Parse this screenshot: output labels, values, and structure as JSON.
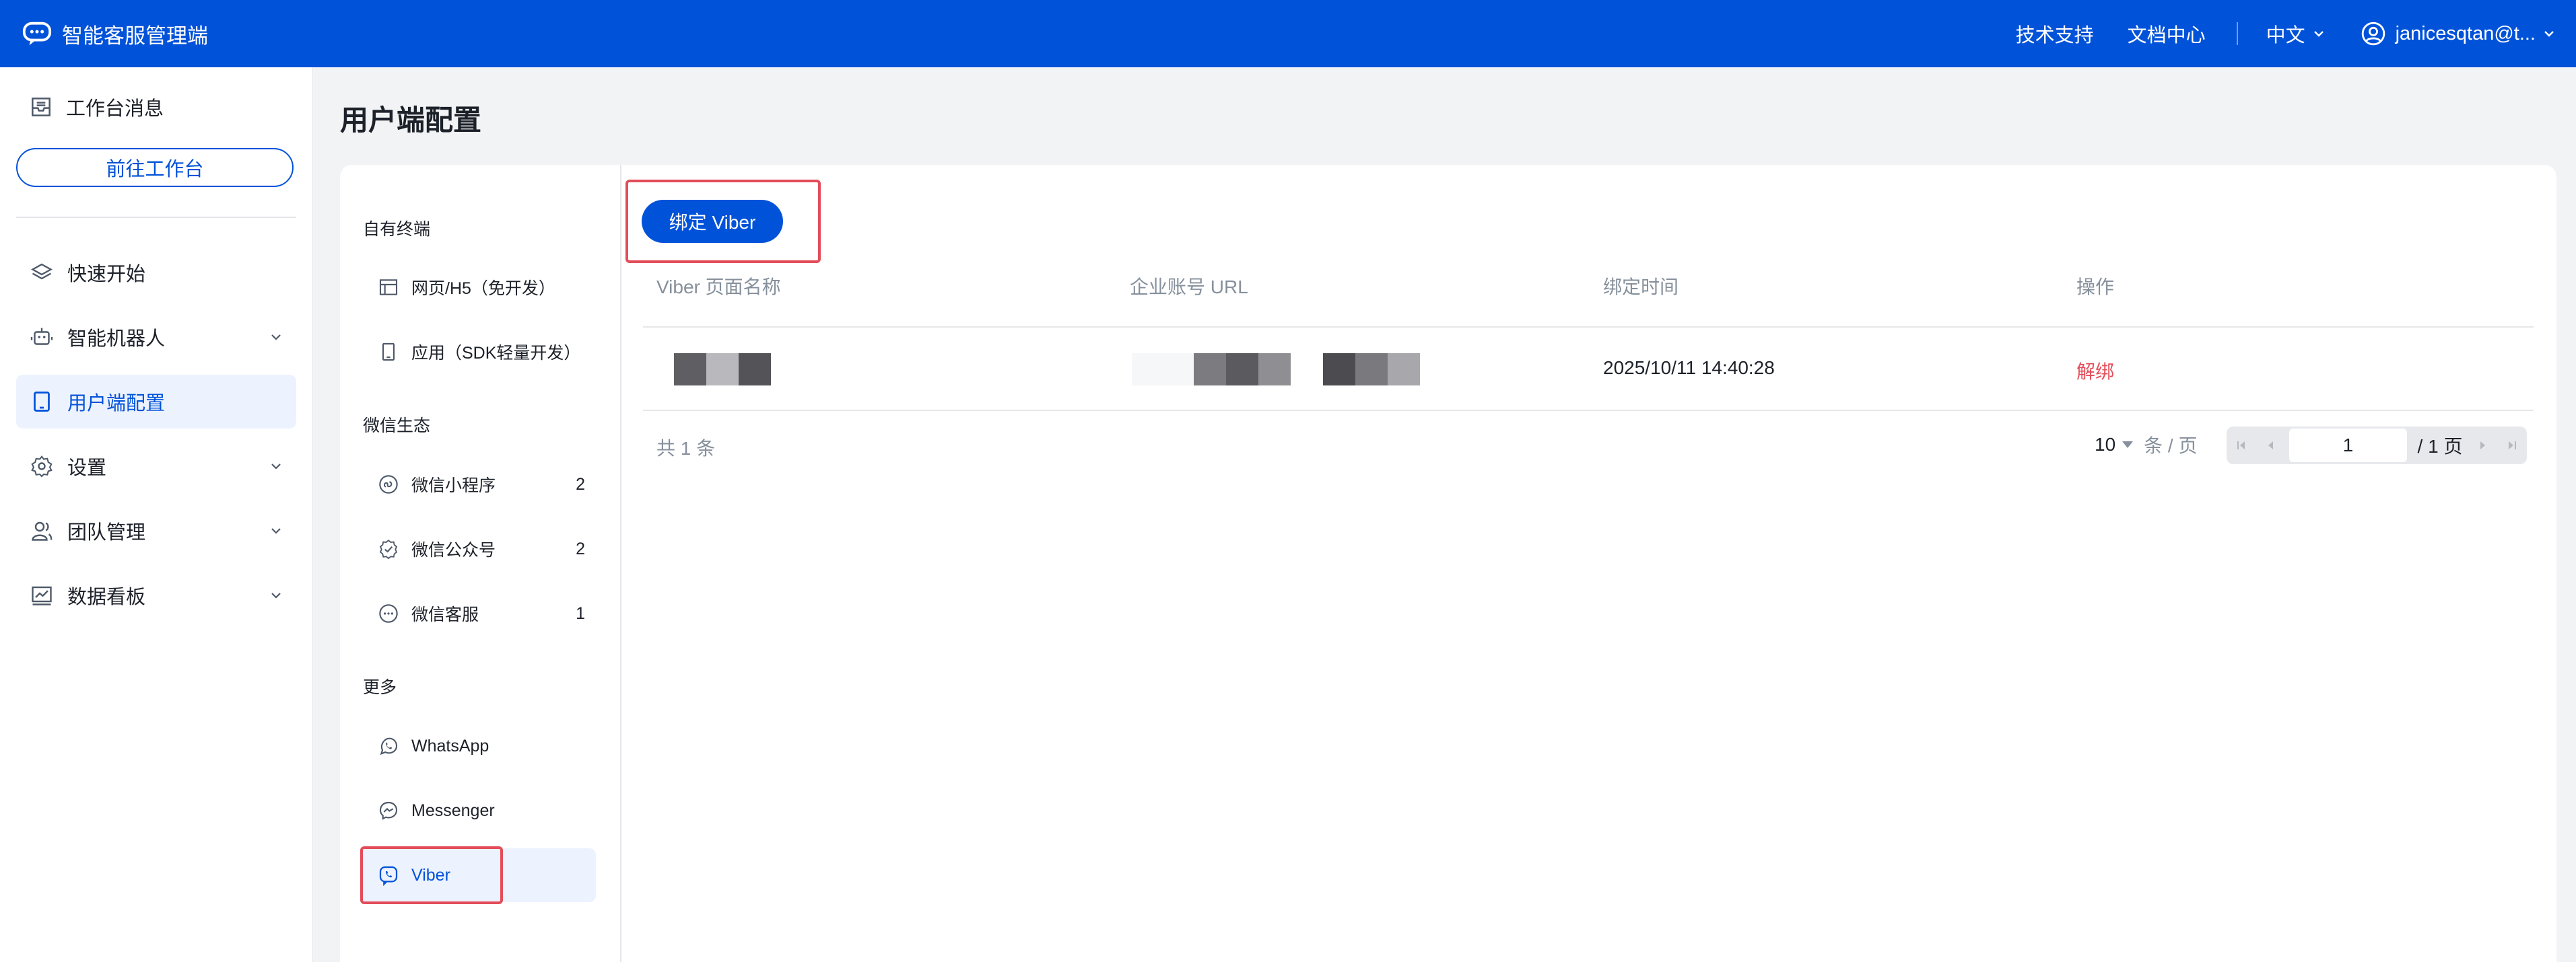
{
  "topbar": {
    "app_title": "智能客服管理端",
    "brand_icon": "chat-bubble-icon",
    "links": [
      "技术支持",
      "文档中心"
    ],
    "language": "中文",
    "user": "janicesqtan@t..."
  },
  "sidebar": {
    "workspace_message": "工作台消息",
    "goto_workspace": "前往工作台",
    "items": [
      {
        "label": "快速开始",
        "icon": "layers-icon",
        "expandable": false
      },
      {
        "label": "智能机器人",
        "icon": "robot-icon",
        "expandable": true
      },
      {
        "label": "用户端配置",
        "icon": "tablet-icon",
        "expandable": false,
        "active": true
      },
      {
        "label": "设置",
        "icon": "gear-icon",
        "expandable": true
      },
      {
        "label": "团队管理",
        "icon": "team-icon",
        "expandable": true
      },
      {
        "label": "数据看板",
        "icon": "chart-icon",
        "expandable": true
      }
    ]
  },
  "main": {
    "page_title": "用户端配置",
    "subnav": {
      "sections": [
        {
          "title": "自有终端",
          "items": [
            {
              "label": "网页/H5（免开发）",
              "icon": "webpage-icon"
            },
            {
              "label": "应用（SDK轻量开发）",
              "icon": "mobile-icon"
            }
          ]
        },
        {
          "title": "微信生态",
          "items": [
            {
              "label": "微信小程序",
              "icon": "miniprogram-icon",
              "count": "2"
            },
            {
              "label": "微信公众号",
              "icon": "official-account-icon",
              "count": "2"
            },
            {
              "label": "微信客服",
              "icon": "wechat-service-icon",
              "count": "1"
            }
          ]
        },
        {
          "title": "更多",
          "items": [
            {
              "label": "WhatsApp",
              "icon": "whatsapp-icon"
            },
            {
              "label": "Messenger",
              "icon": "messenger-icon"
            },
            {
              "label": "Viber",
              "icon": "viber-icon",
              "active": true
            }
          ]
        }
      ]
    },
    "bind_button": "绑定 Viber",
    "table": {
      "columns": [
        "Viber 页面名称",
        "企业账号 URL",
        "绑定时间",
        "操作"
      ],
      "rows": [
        {
          "bind_time": "2025/10/11 14:40:28",
          "action": "解绑"
        }
      ]
    },
    "pagination": {
      "total_text": "共 1 条",
      "page_size": "10",
      "page_size_unit": "条 / 页",
      "current_page": "1",
      "total_pages": "/ 1 页"
    }
  },
  "colors": {
    "primary": "#0052d9",
    "danger": "#e34d59",
    "highlight_box": "#e34d59",
    "active_bg": "#ecf2fe"
  }
}
